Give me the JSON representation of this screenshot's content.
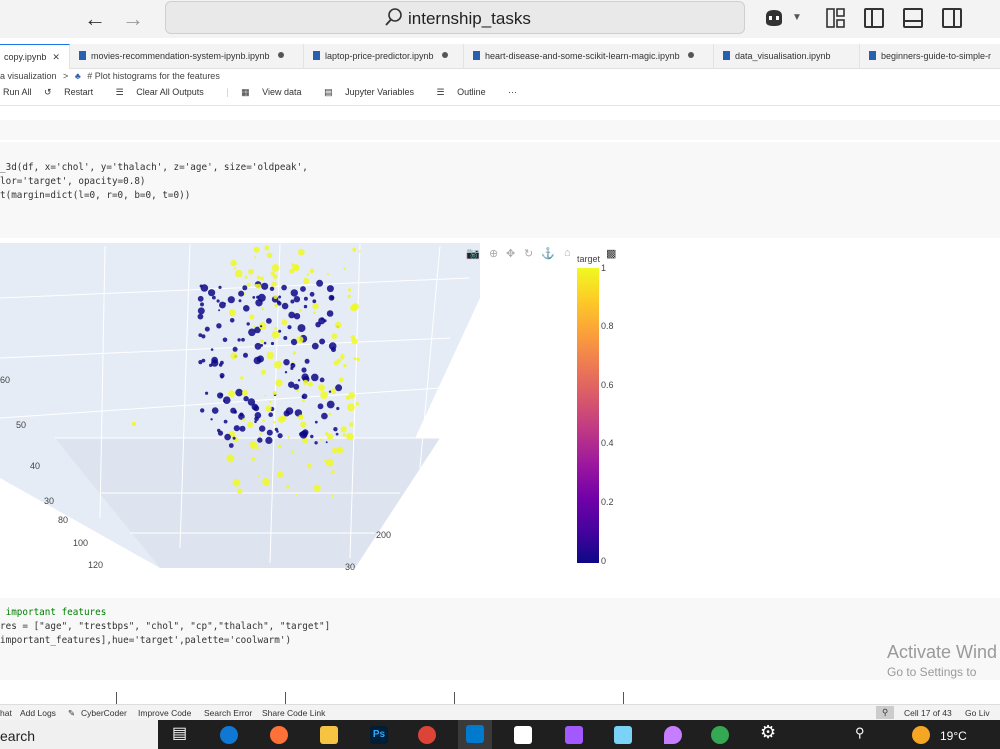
{
  "titlebar": {
    "back_icon": "arrow-left-icon",
    "forward_icon": "arrow-right-icon",
    "search_text": "internship_tasks"
  },
  "tabs": [
    {
      "label": "copy.ipynb",
      "active": true
    },
    {
      "label": "movies-recommendation-system-ipynb.ipynb"
    },
    {
      "label": "laptop-price-predictor.ipynb"
    },
    {
      "label": "heart-disease-and-some-scikit-learn-magic.ipynb"
    },
    {
      "label": "data_visualisation.ipynb"
    },
    {
      "label": "beginners-guide-to-simple-r"
    }
  ],
  "breadcrumb": {
    "part1": "a visualization",
    "sep": ">",
    "part2": "# Plot histograms for the features"
  },
  "toolbar": {
    "run_all": "Run All",
    "restart": "Restart",
    "clear_all": "Clear All Outputs",
    "view_data": "View data",
    "jupyter_vars": "Jupyter Variables",
    "outline": "Outline",
    "more": "···"
  },
  "code_cell_1": {
    "line1": "_3d(df, x='chol', y='thalach', z='age', size='oldpeak',",
    "line2": "lor='target', opacity=0.8)",
    "line3": "t(margin=dict(l=0, r=0, b=0, t=0))"
  },
  "chart_data": {
    "type": "scatter",
    "colorbar_title": "target",
    "colorbar_ticks": [
      "1",
      "0.8",
      "0.6",
      "0.4",
      "0.2",
      "0"
    ],
    "colorscale": [
      "#0d0887",
      "#46039f",
      "#7201a8",
      "#9c179e",
      "#bd3786",
      "#d8576b",
      "#ed7953",
      "#fb9f3a",
      "#fdca26",
      "#f0f921"
    ],
    "z_tick_labels": [
      "60",
      "50",
      "40",
      "30"
    ],
    "y_tick_labels": [
      "80",
      "100",
      "120"
    ],
    "x_tick_labels": [
      "200",
      "30"
    ],
    "series": [
      {
        "target": 0,
        "color": "#0d0887"
      },
      {
        "target": 1,
        "color": "#f0f921"
      }
    ]
  },
  "code_cell_2": {
    "line1": " important features",
    "line2": "res = [\"age\", \"trestbps\", \"chol\", \"cp\",\"thalach\", \"target\"]",
    "line3": "important_features],hue='target',palette='coolwarm')"
  },
  "watermark": {
    "line1": "Activate Wind",
    "line2": "Go to Settings to"
  },
  "statusbar": {
    "chat": "hat",
    "add_logs": "Add Logs",
    "cybercoder": "CyberCoder",
    "improve": "Improve Code",
    "search_error": "Search Error",
    "share": "Share Code Link",
    "cell_info": "Cell 17 of 43",
    "go_live": "Go Liv"
  },
  "taskbar": {
    "search": "earch",
    "temperature": "19°C"
  }
}
